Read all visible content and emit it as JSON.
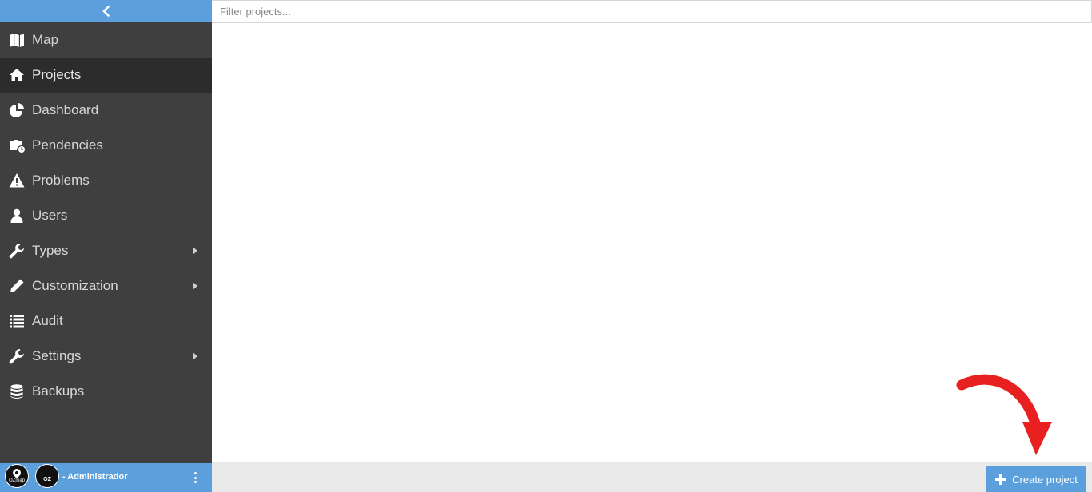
{
  "sidebar": {
    "items": [
      {
        "label": "Map"
      },
      {
        "label": "Projects"
      },
      {
        "label": "Dashboard"
      },
      {
        "label": "Pendencies"
      },
      {
        "label": "Problems"
      },
      {
        "label": "Users"
      },
      {
        "label": "Types"
      },
      {
        "label": "Customization"
      },
      {
        "label": "Audit"
      },
      {
        "label": "Settings"
      },
      {
        "label": "Backups"
      }
    ],
    "user": {
      "logo_a_text": "OZmap",
      "logo_b_text": "OZ",
      "role_label": "- Administrador"
    }
  },
  "main": {
    "filter_placeholder": "Filter projects...",
    "create_button_label": "Create project"
  },
  "colors": {
    "accent": "#5b9fdd",
    "sidebar_bg": "#3f3f3f",
    "active_item_bg": "#2c2c2c",
    "annotation_arrow": "#e8201f"
  }
}
